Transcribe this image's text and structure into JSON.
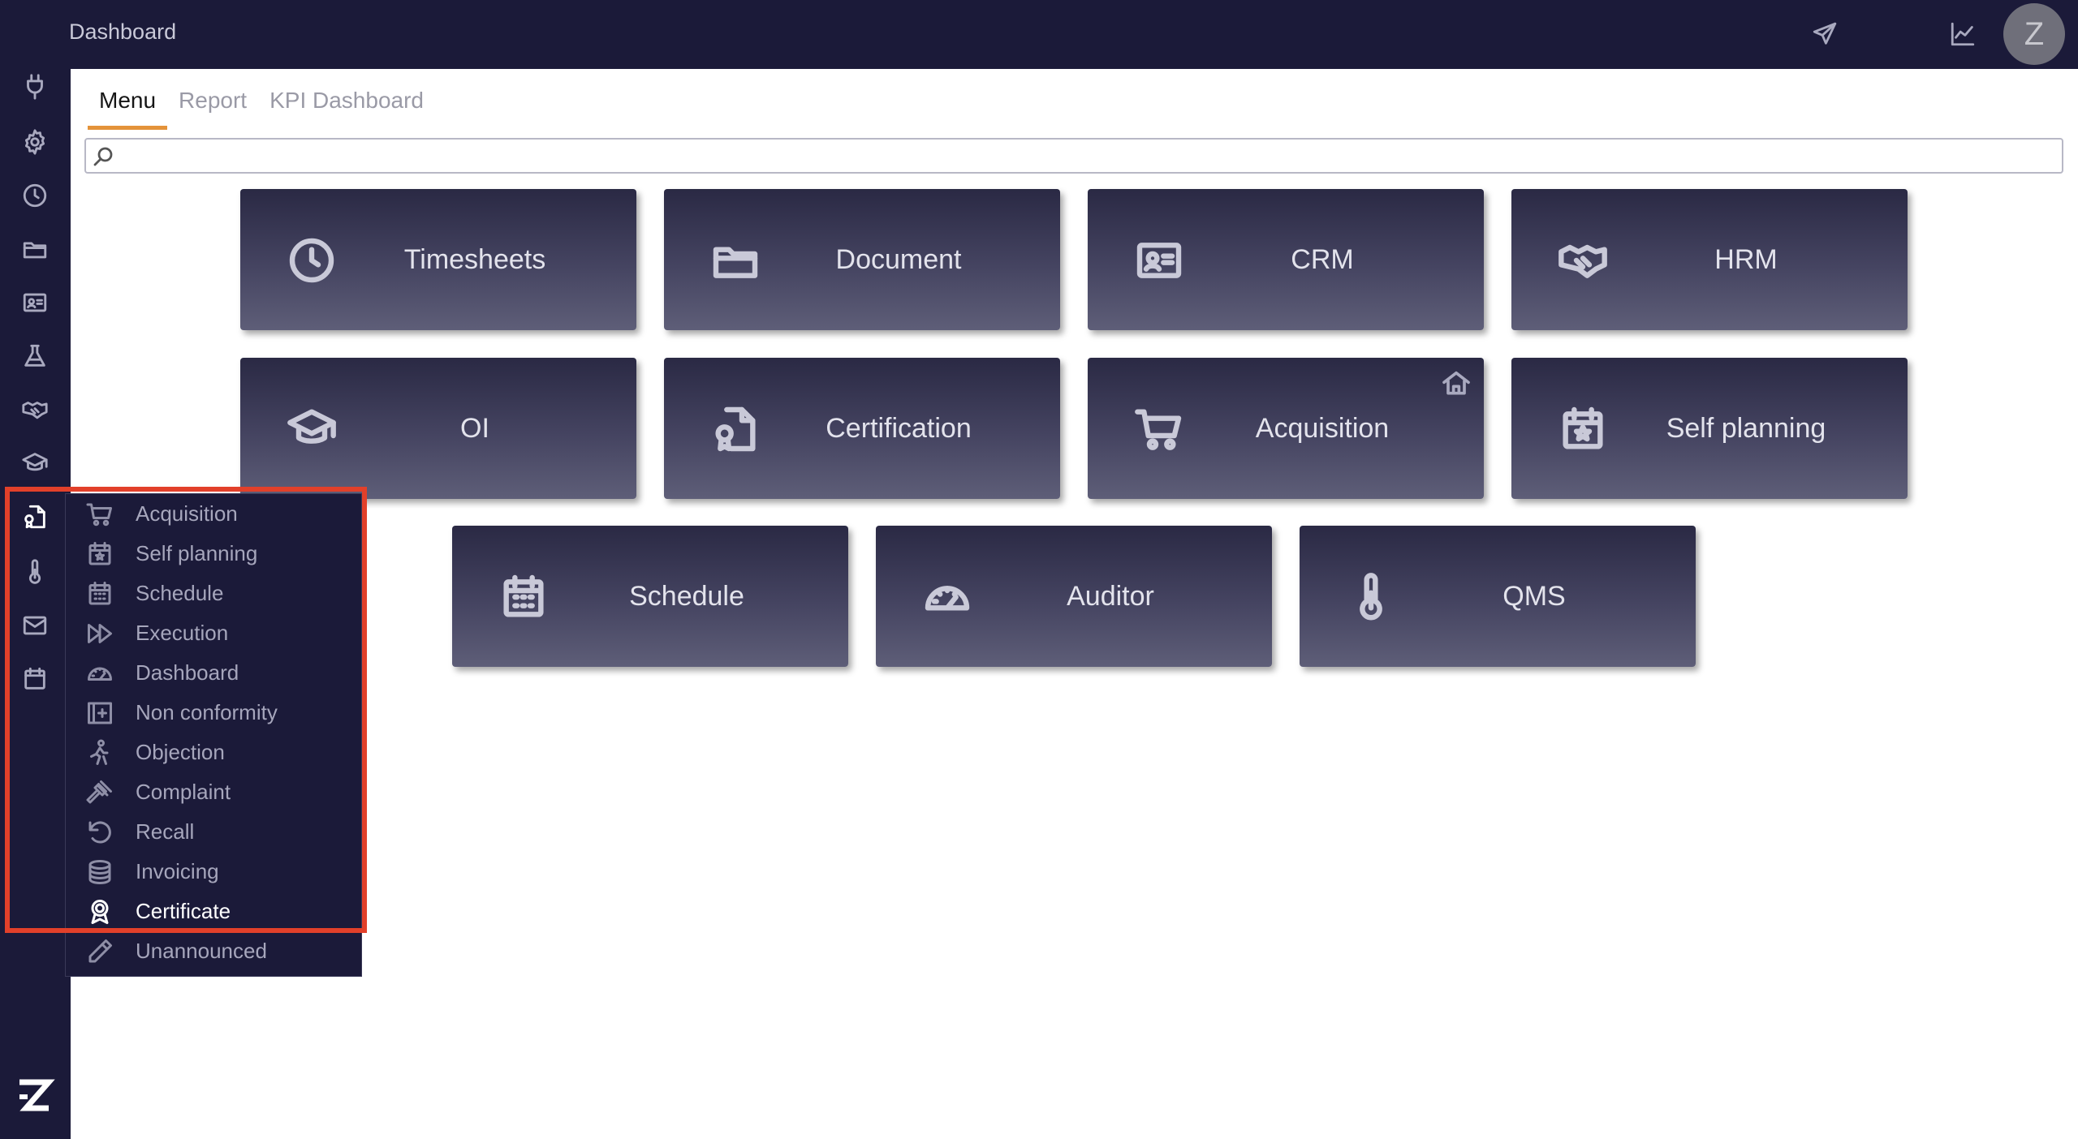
{
  "header": {
    "title": "Dashboard",
    "icons": [
      "hamburger-icon",
      "send-icon",
      "chart-line-icon"
    ],
    "avatar_initial": "Z"
  },
  "sidebar": {
    "icons": [
      "plug-icon",
      "gear-icon",
      "clock-icon",
      "folder-icon",
      "id-card-icon",
      "flask-icon",
      "handshake-icon",
      "graduation-cap-icon",
      "certificate-file-icon",
      "thermometer-icon",
      "mail-icon",
      "calendar-icon"
    ],
    "active_icon": "certificate-file-icon",
    "logo": "Z"
  },
  "tabs": [
    {
      "label": "Menu",
      "active": true
    },
    {
      "label": "Report",
      "active": false
    },
    {
      "label": "KPI Dashboard",
      "active": false
    }
  ],
  "search": {
    "placeholder": ""
  },
  "tiles": [
    {
      "label": "Timesheets",
      "icon": "clock-icon"
    },
    {
      "label": "Document",
      "icon": "folder-icon"
    },
    {
      "label": "CRM",
      "icon": "id-card-icon"
    },
    {
      "label": "HRM",
      "icon": "handshake-icon"
    },
    {
      "label": "OI",
      "icon": "graduation-cap-icon"
    },
    {
      "label": "Certification",
      "icon": "certificate-file-icon"
    },
    {
      "label": "Acquisition",
      "icon": "cart-icon",
      "home_badge": "home-icon"
    },
    {
      "label": "Self planning",
      "icon": "calendar-star-icon"
    },
    {
      "label": "Schedule",
      "icon": "calendar-grid-icon"
    },
    {
      "label": "Auditor",
      "icon": "gauge-icon"
    },
    {
      "label": "QMS",
      "icon": "thermometer-icon"
    }
  ],
  "submenu": {
    "items": [
      {
        "label": "Acquisition",
        "icon": "cart-icon"
      },
      {
        "label": "Self planning",
        "icon": "calendar-star-icon"
      },
      {
        "label": "Schedule",
        "icon": "calendar-grid-icon"
      },
      {
        "label": "Execution",
        "icon": "fast-forward-icon"
      },
      {
        "label": "Dashboard",
        "icon": "gauge-icon"
      },
      {
        "label": "Non conformity",
        "icon": "plus-square-icon"
      },
      {
        "label": "Objection",
        "icon": "walking-person-icon"
      },
      {
        "label": "Complaint",
        "icon": "gavel-icon"
      },
      {
        "label": "Recall",
        "icon": "undo-icon"
      },
      {
        "label": "Invoicing",
        "icon": "coins-icon"
      },
      {
        "label": "Certificate",
        "icon": "award-icon",
        "active": true
      },
      {
        "label": "Unannounced",
        "icon": "pen-icon"
      }
    ]
  },
  "colors": {
    "navbar": "#1b1a39",
    "tab_underline": "#e4933a",
    "highlight": "#e2402a"
  }
}
